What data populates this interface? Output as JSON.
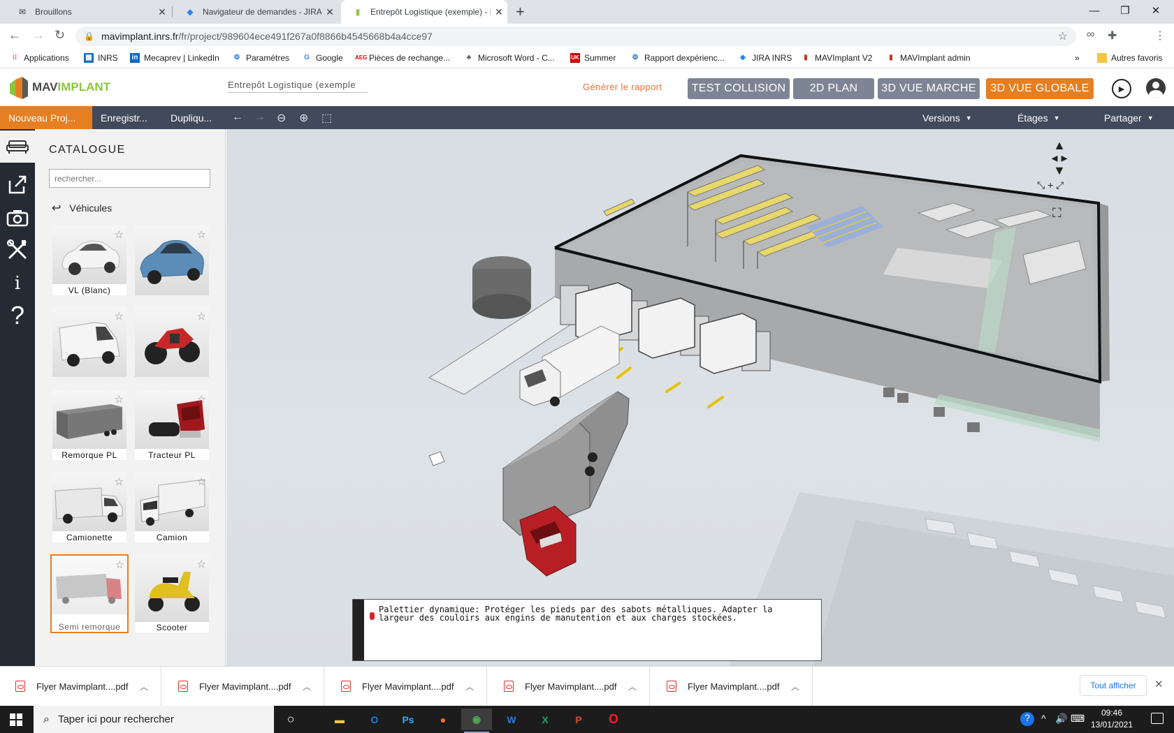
{
  "browser": {
    "tabs": [
      {
        "title": "Brouillons",
        "favicon": "mail-icon"
      },
      {
        "title": "Navigateur de demandes - JIRA INRS",
        "favicon": "jira-icon"
      },
      {
        "title": "Entrepôt Logistique (exemple) - MAVImplant",
        "favicon": "mavimplant-icon",
        "active": true
      }
    ],
    "url_host": "mavimplant.inrs.fr",
    "url_path": "/fr/project/989604ece491f267a0f8866b4545668b4a4cce97",
    "bookmarks": [
      "Applications",
      "INRS",
      "Mecaprev | LinkedIn",
      "Paramètres",
      "Google",
      "Pièces de rechange...",
      "Microsoft Word - C...",
      "Summer",
      "Rapport dexpérienc...",
      "JIRA INRS",
      "MAVImplant V2",
      "MAVImplant admin"
    ],
    "bookmarks_more": "»",
    "other_bookmarks": "Autres favoris"
  },
  "app": {
    "logo_text_a": "MAV",
    "logo_text_b": "IMPLANT",
    "project_name": "Entrepôt Logistique (exemple",
    "generate_report": "Générer le rapport",
    "buttons": {
      "test_collision": "TEST COLLISION",
      "plan_2d": "2D PLAN",
      "vue_marche_3d": "3D VUE MARCHE",
      "vue_globale_3d": "3D VUE GLOBALE"
    },
    "colors": {
      "accent": "#e67e22",
      "button_grey": "#7d8594",
      "menubar": "#414a5a",
      "rail": "#252b35"
    }
  },
  "menubar": {
    "new_project": "Nouveau Proj...",
    "save": "Enregistr...",
    "duplicate": "Dupliqu...",
    "versions": "Versions",
    "floors": "Étages",
    "share": "Partager"
  },
  "catalog": {
    "title": "CATALOGUE",
    "search_placeholder": "rechercher...",
    "category": "Véhicules",
    "items": [
      {
        "label": "VL (Blanc)"
      },
      {
        "label": ""
      },
      {
        "label": ""
      },
      {
        "label": ""
      },
      {
        "label": "Remorque PL"
      },
      {
        "label": "Tracteur PL"
      },
      {
        "label": "Camionette"
      },
      {
        "label": "Camion"
      },
      {
        "label": "Semi remorque",
        "selected": true
      },
      {
        "label": "Scooter"
      }
    ]
  },
  "tooltip": {
    "text": "Palettier dynamique: Protéger les pieds par des sabots métalliques. Adapter la largeur des couloirs aux engins de manutention et aux charges stockées."
  },
  "downloads": {
    "items": [
      "Flyer Mavimplant....pdf",
      "Flyer Mavimplant....pdf",
      "Flyer Mavimplant....pdf",
      "Flyer Mavimplant....pdf",
      "Flyer Mavimplant....pdf"
    ],
    "show_all": "Tout afficher"
  },
  "taskbar": {
    "search_placeholder": "Taper ici pour rechercher",
    "time": "09:46",
    "date": "13/01/2021"
  }
}
